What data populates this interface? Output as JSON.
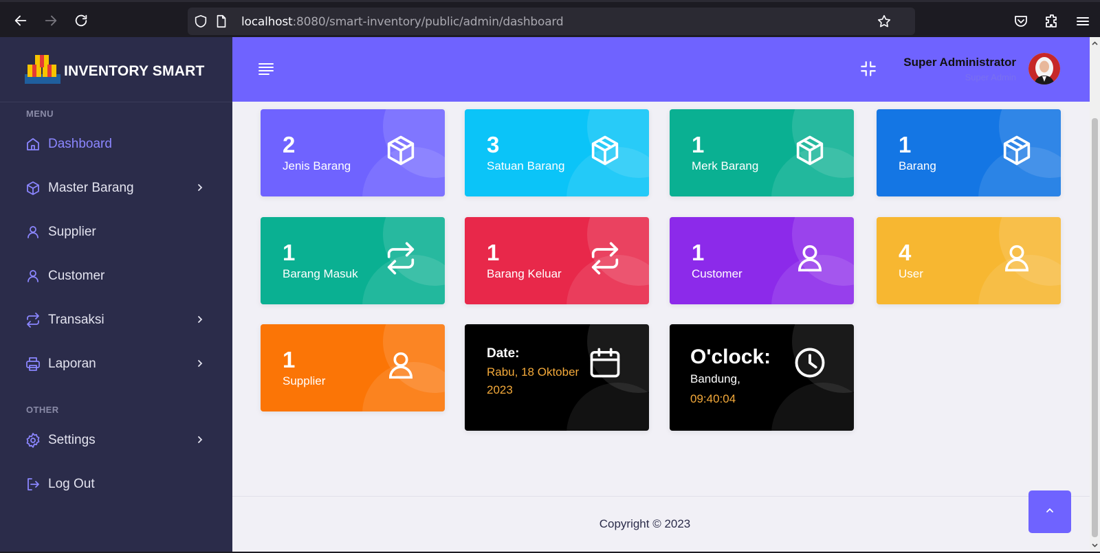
{
  "browser": {
    "url_host": "localhost",
    "url_path": ":8080/smart-inventory/public/admin/dashboard"
  },
  "sidebar": {
    "brand": "INVENTORY SMART",
    "menu_heading": "MENU",
    "other_heading": "OTHER",
    "items": [
      {
        "label": "Dashboard",
        "icon": "home-icon",
        "active": true
      },
      {
        "label": "Master Barang",
        "icon": "box-icon",
        "has_children": true
      },
      {
        "label": "Supplier",
        "icon": "user-icon"
      },
      {
        "label": "Customer",
        "icon": "user-icon"
      },
      {
        "label": "Transaksi",
        "icon": "repeat-icon",
        "has_children": true
      },
      {
        "label": "Laporan",
        "icon": "printer-icon",
        "has_children": true
      }
    ],
    "other_items": [
      {
        "label": "Settings",
        "icon": "gear-icon",
        "has_children": true
      },
      {
        "label": "Log Out",
        "icon": "logout-icon"
      }
    ]
  },
  "header": {
    "user_name": "Super Administrator",
    "user_role": "Super Admin"
  },
  "cards": [
    {
      "count": "2",
      "label": "Jenis Barang",
      "icon": "box-icon",
      "color": "#6f63ff"
    },
    {
      "count": "3",
      "label": "Satuan Barang",
      "icon": "box-icon",
      "color": "#0bc4f8"
    },
    {
      "count": "1",
      "label": "Merk Barang",
      "icon": "box-icon",
      "color": "#0ab092"
    },
    {
      "count": "1",
      "label": "Barang",
      "icon": "box-icon",
      "color": "#1476e4"
    },
    {
      "count": "1",
      "label": "Barang Masuk",
      "icon": "repeat-icon",
      "color": "#0ab092"
    },
    {
      "count": "1",
      "label": "Barang Keluar",
      "icon": "repeat-icon",
      "color": "#e8284a"
    },
    {
      "count": "1",
      "label": "Customer",
      "icon": "user-icon",
      "color": "#8c2aea"
    },
    {
      "count": "4",
      "label": "User",
      "icon": "user-icon",
      "color": "#f7b731"
    },
    {
      "count": "1",
      "label": "Supplier",
      "icon": "user-icon",
      "color": "#fb7506"
    }
  ],
  "date_card": {
    "heading": "Date:",
    "value": "Rabu, 18 Oktober 2023"
  },
  "clock_card": {
    "heading": "O'clock:",
    "city": "Bandung,",
    "time": "09:40:04"
  },
  "footer": {
    "copyright": "Copyright © 2023"
  },
  "colors": {
    "accent": "#6f63ff",
    "sidebar": "#2b2c4a",
    "highlight": "#f3a93a"
  }
}
